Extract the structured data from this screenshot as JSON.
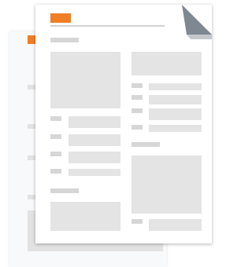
{
  "colors": {
    "background": "#ffffff",
    "page": "#ffffff",
    "back_page": "#f8f9fa",
    "accent": "#f07e26",
    "placeholder": "#e4e4e4",
    "placeholder_dark": "#d6d6d6",
    "fold_dark": "#7f8791",
    "fold_light": "#c4c8cc"
  },
  "illustration": {
    "subject": "document-stack-icon",
    "pages": 2
  }
}
